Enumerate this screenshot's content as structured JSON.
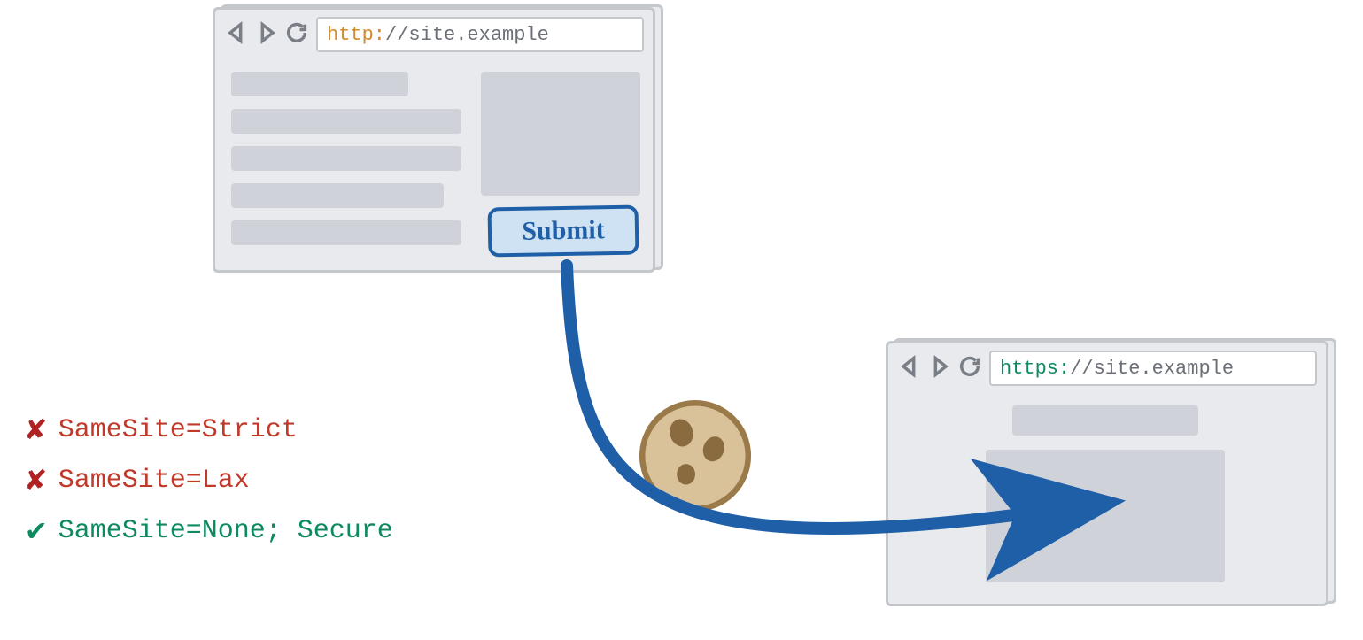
{
  "top_browser": {
    "scheme": "http:",
    "url_rest": "//site.example",
    "submit_label": "Submit"
  },
  "bottom_browser": {
    "scheme": "https:",
    "url_rest": "//site.example"
  },
  "legend": {
    "strict": "SameSite=Strict",
    "lax": "SameSite=Lax",
    "none": "SameSite=None; Secure"
  },
  "icons": {
    "cookie": "cookie-icon",
    "back": "back-icon",
    "forward": "forward-icon",
    "reload": "reload-icon",
    "cross": "✘",
    "check": "✔"
  }
}
